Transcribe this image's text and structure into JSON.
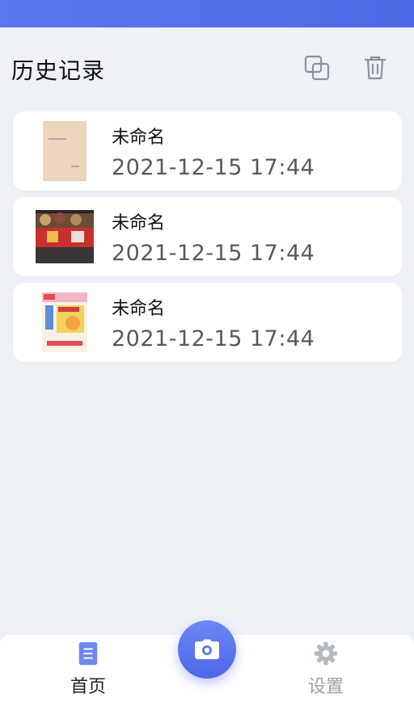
{
  "header": {
    "title": "历史记录",
    "actions": [
      {
        "icon": "copy-icon"
      },
      {
        "icon": "trash-icon"
      }
    ]
  },
  "records": [
    {
      "name": "未命名",
      "date": "2021-12-15 17:44",
      "thumbnail": "document-photo"
    },
    {
      "name": "未命名",
      "date": "2021-12-15 17:44",
      "thumbnail": "food-package-photo"
    },
    {
      "name": "未命名",
      "date": "2021-12-15 17:44",
      "thumbnail": "product-box-photo"
    }
  ],
  "bottom_nav": {
    "home": {
      "label": "首页",
      "icon": "document-icon",
      "active": true
    },
    "camera": {
      "icon": "camera-icon"
    },
    "settings": {
      "label": "设置",
      "icon": "gear-icon",
      "active": false
    }
  },
  "colors": {
    "accent": "#5069e8",
    "background": "#eef1f6",
    "card": "#ffffff",
    "icon_gray": "#9aa0a8"
  }
}
